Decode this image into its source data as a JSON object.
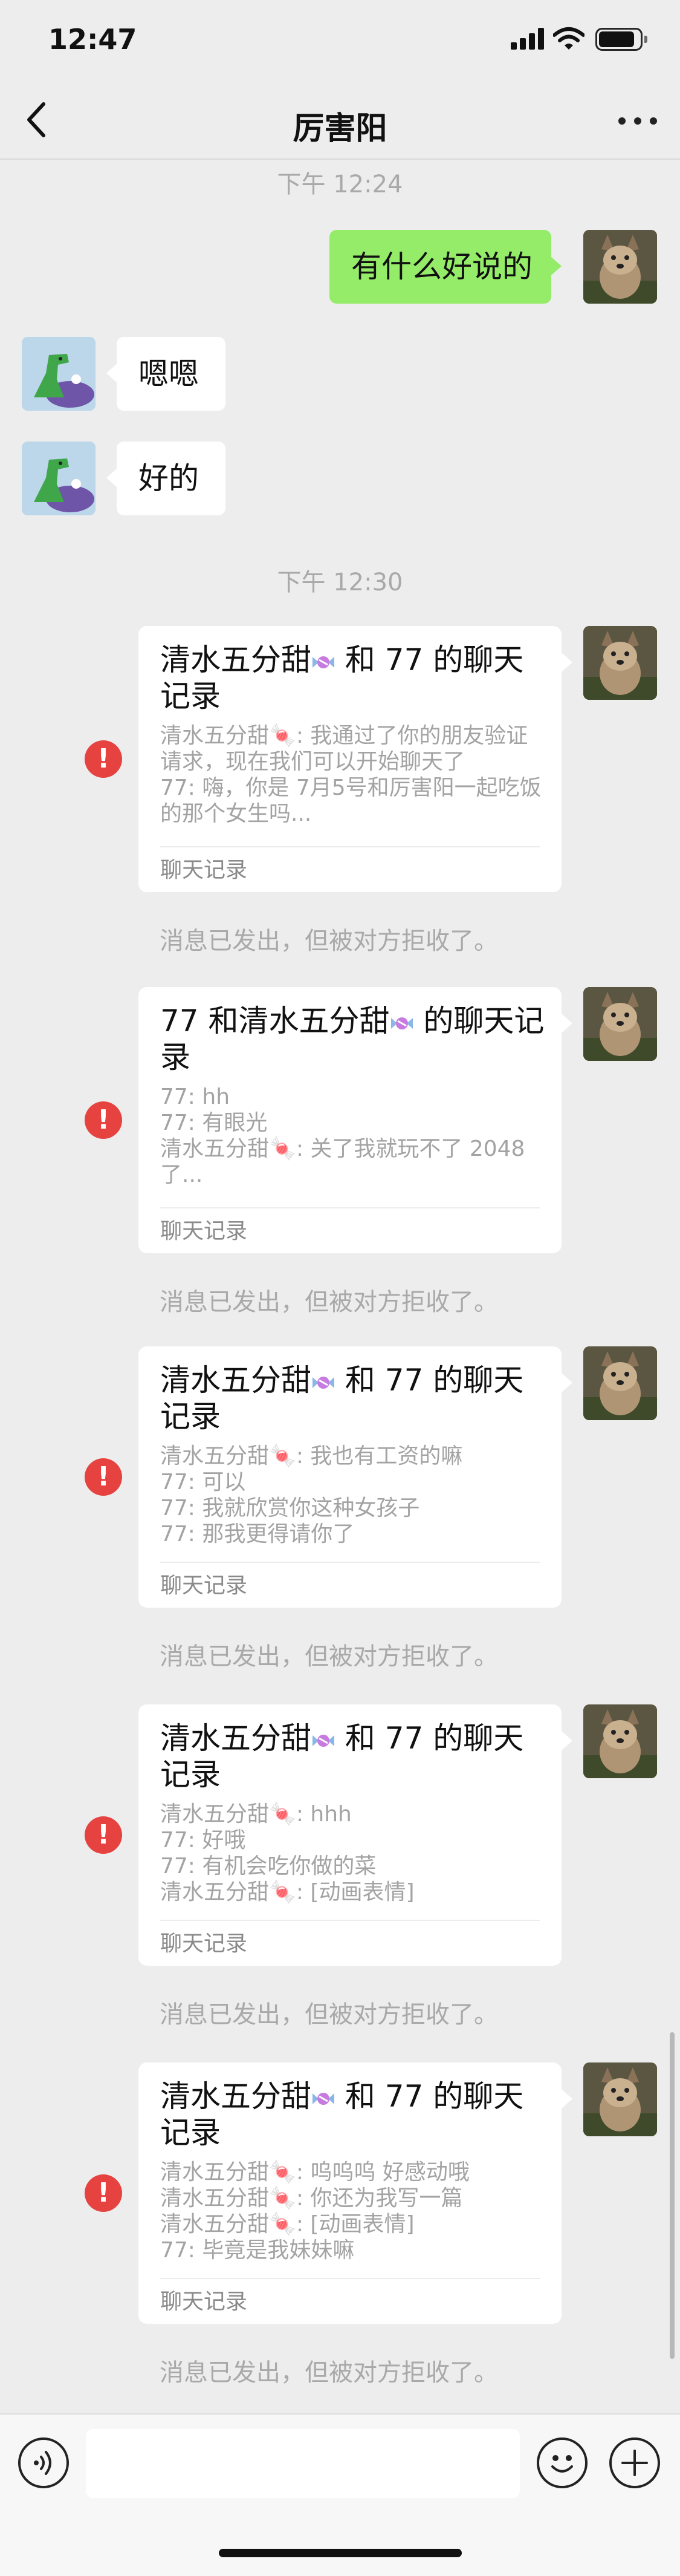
{
  "status_bar": {
    "time": "12:47",
    "battery_level": 0.9
  },
  "header": {
    "title": "厉害阳"
  },
  "messages": {
    "time_1": "下午 12:24",
    "outgoing_1": "有什么好说的",
    "incoming_1": "嗯嗯",
    "incoming_2": "好的",
    "time_2": "下午 12:30"
  },
  "records": [
    {
      "title_a": "清水五分甜",
      "title_b": " 和 77 的聊天记录",
      "lines": [
        "清水五分甜🍬: 我通过了你的朋友验证请求，现在我们可以开始聊天了",
        "77: 嗨，你是 7月5号和厉害阳一起吃饭的那个女生吗..."
      ],
      "footer": "聊天记录",
      "rejected": "消息已发出，但被对方拒收了。"
    },
    {
      "title_a": "77 和清水五分甜",
      "title_b": " 的聊天记录",
      "lines": [
        "77: hh",
        "77: 有眼光",
        "清水五分甜🍬: 关了我就玩不了 2048 了..."
      ],
      "footer": "聊天记录",
      "rejected": "消息已发出，但被对方拒收了。"
    },
    {
      "title_a": "清水五分甜",
      "title_b": " 和 77 的聊天记录",
      "lines": [
        "清水五分甜🍬: 我也有工资的嘛",
        "77: 可以",
        "77: 我就欣赏你这种女孩子",
        "77: 那我更得请你了"
      ],
      "footer": "聊天记录",
      "rejected": "消息已发出，但被对方拒收了。"
    },
    {
      "title_a": "清水五分甜",
      "title_b": " 和 77 的聊天记录",
      "lines": [
        "清水五分甜🍬: hhh",
        "77: 好哦",
        "77: 有机会吃你做的菜",
        "清水五分甜🍬: [动画表情]"
      ],
      "footer": "聊天记录",
      "rejected": "消息已发出，但被对方拒收了。"
    },
    {
      "title_a": "清水五分甜",
      "title_b": " 和 77 的聊天记录",
      "lines": [
        "清水五分甜🍬: 呜呜呜 好感动哦",
        "清水五分甜🍬: 你还为我写一篇",
        "清水五分甜🍬: [动画表情]",
        "77: 毕竟是我妹妹嘛"
      ],
      "footer": "聊天记录",
      "rejected": "消息已发出，但被对方拒收了。"
    }
  ],
  "icons": {
    "back": "chevron-left-icon",
    "more": "more-dots-icon",
    "error": "exclamation-icon",
    "voice": "voice-icon",
    "emoji": "emoji-icon",
    "plus": "plus-icon"
  },
  "colors": {
    "background": "#ededed",
    "outgoing_bubble": "#95ec69",
    "incoming_bubble": "#ffffff",
    "error": "#e64340",
    "muted_text": "#a9a9a9"
  }
}
